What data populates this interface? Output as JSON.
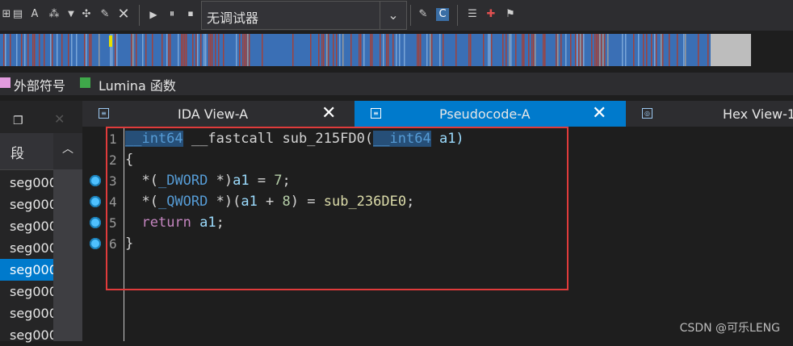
{
  "toolbar": {
    "debugger_select": "无调试器",
    "icons": [
      "sections-icon",
      "data-icon",
      "ascii-string-icon",
      "struct-icon",
      "dropdown-icon",
      "sparkle-icon",
      "edit-icon",
      "close-icon",
      "play-icon",
      "pause-icon",
      "stop-icon",
      "chevron-down-icon",
      "code-icon",
      "pseudocode-icon",
      "notes-icon",
      "bookmark-icon",
      "flag-icon"
    ]
  },
  "legend": {
    "items": [
      {
        "label": "外部符号",
        "color": "#e29bde"
      },
      {
        "label": "Lumina 函数",
        "color": "#3fa84a"
      }
    ]
  },
  "tabs": [
    {
      "label": "IDA View-A",
      "active": false,
      "close": "✕"
    },
    {
      "label": "Pseudocode-A",
      "active": true,
      "close": "✕"
    },
    {
      "label": "Hex View-1",
      "active": false
    }
  ],
  "segments": {
    "header": "段",
    "rows": [
      "seg000",
      "seg000",
      "seg000",
      "seg000",
      "seg000",
      "seg000",
      "seg000",
      "seg000"
    ],
    "selected_index": 4
  },
  "code": {
    "line_numbers": [
      "1",
      "2",
      "3",
      "4",
      "5",
      "6"
    ],
    "lines": [
      {
        "t1": "__int64",
        "t2": " __fastcall sub_215FD0(",
        "t3": "__int64",
        "t4": " a1)"
      },
      {
        "t1": "{"
      },
      {
        "t1": "  *(",
        "t2": "_DWORD",
        "t3": " *)",
        "t4": "a1",
        "t5": " = ",
        "t6": "7",
        "t7": ";"
      },
      {
        "t1": "  *(",
        "t2": "_QWORD",
        "t3": " *)(",
        "t4": "a1",
        "t5": " + ",
        "t6": "8",
        "t7": ") = ",
        "t8": "sub_236DE0",
        "t9": ";"
      },
      {
        "t1": "  ",
        "t2": "return",
        "t3": " ",
        "t4": "a1",
        "t5": ";"
      },
      {
        "t1": "}"
      }
    ],
    "breakpoint_lines": [
      3,
      4,
      5,
      6
    ]
  },
  "watermark": "CSDN @可乐LENG"
}
